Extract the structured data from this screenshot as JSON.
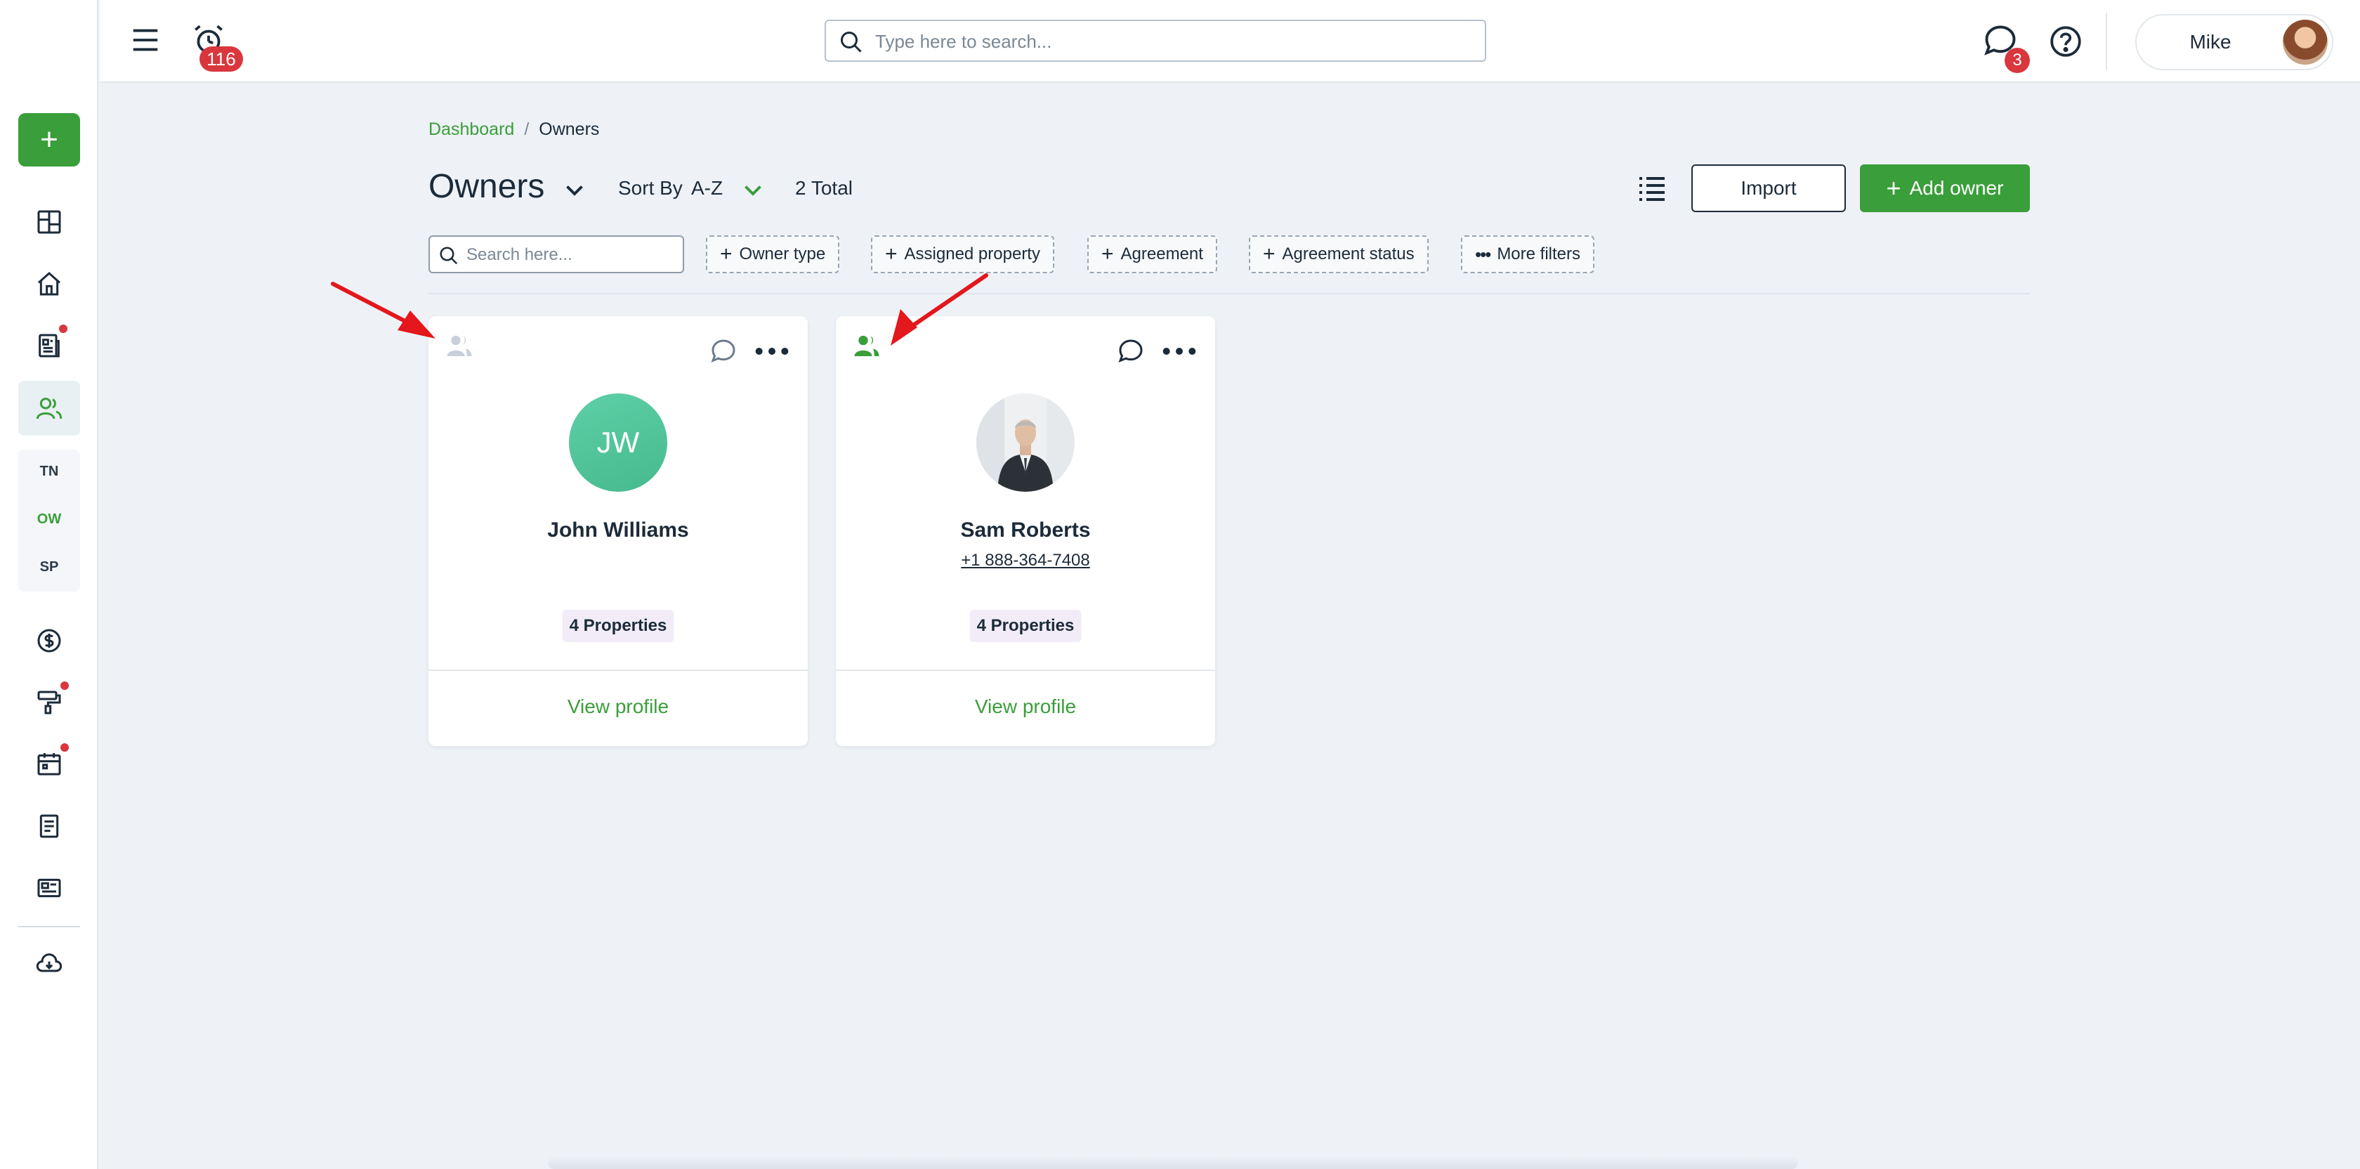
{
  "header": {
    "notification_count": "116",
    "search_placeholder": "Type here to search...",
    "message_count": "3",
    "user_name": "Mike"
  },
  "sidebar": {
    "sub_items": [
      "TN",
      "OW",
      "SP"
    ]
  },
  "breadcrumb": {
    "root": "Dashboard",
    "separator": "/",
    "current": "Owners"
  },
  "toolbar": {
    "title": "Owners",
    "sort_label": "Sort By",
    "sort_value": "A-Z",
    "total": "2 Total",
    "import_label": "Import",
    "add_owner_label": "Add owner"
  },
  "filters": {
    "search_placeholder": "Search here...",
    "chips": [
      "Owner type",
      "Assigned property",
      "Agreement",
      "Agreement status",
      "More filters"
    ]
  },
  "owners": [
    {
      "initials": "JW",
      "name": "John Williams",
      "phone": "",
      "properties": "4 Properties",
      "view_label": "View profile"
    },
    {
      "initials": "",
      "name": "Sam Roberts",
      "phone": "+1 888-364-7408",
      "properties": "4 Properties",
      "view_label": "View profile"
    }
  ],
  "colors": {
    "brand_green": "#3a9e3a",
    "badge_red": "#d9363e",
    "annotation_arrow": "#e3171c"
  }
}
